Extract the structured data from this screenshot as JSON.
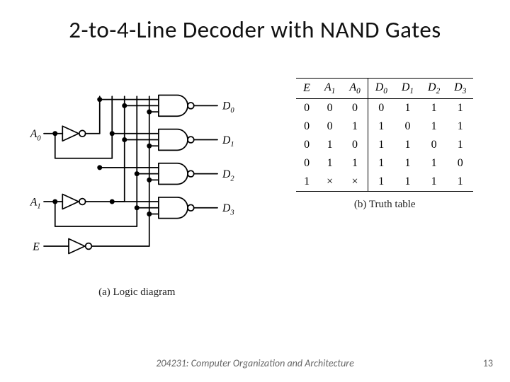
{
  "title": "2-to-4-Line Decoder with NAND Gates",
  "diagram": {
    "caption": "(a) Logic diagram",
    "inputs": {
      "A0": "A",
      "A0sub": "0",
      "A1": "A",
      "A1sub": "1",
      "E": "E"
    },
    "outputs": {
      "D0": "D",
      "D0sub": "0",
      "D1": "D",
      "D1sub": "1",
      "D2": "D",
      "D2sub": "2",
      "D3": "D",
      "D3sub": "3"
    }
  },
  "truth_table": {
    "caption": "(b) Truth table",
    "headers": [
      "E",
      "A1",
      "A0",
      "D0",
      "D1",
      "D2",
      "D3"
    ],
    "header_subs": [
      "",
      "1",
      "0",
      "0",
      "1",
      "2",
      "3"
    ],
    "rows": [
      [
        "0",
        "0",
        "0",
        "0",
        "1",
        "1",
        "1"
      ],
      [
        "0",
        "0",
        "1",
        "1",
        "0",
        "1",
        "1"
      ],
      [
        "0",
        "1",
        "0",
        "1",
        "1",
        "0",
        "1"
      ],
      [
        "0",
        "1",
        "1",
        "1",
        "1",
        "1",
        "0"
      ],
      [
        "1",
        "×",
        "×",
        "1",
        "1",
        "1",
        "1"
      ]
    ]
  },
  "footer": "204231: Computer Organization and Architecture",
  "pagenum": "13"
}
